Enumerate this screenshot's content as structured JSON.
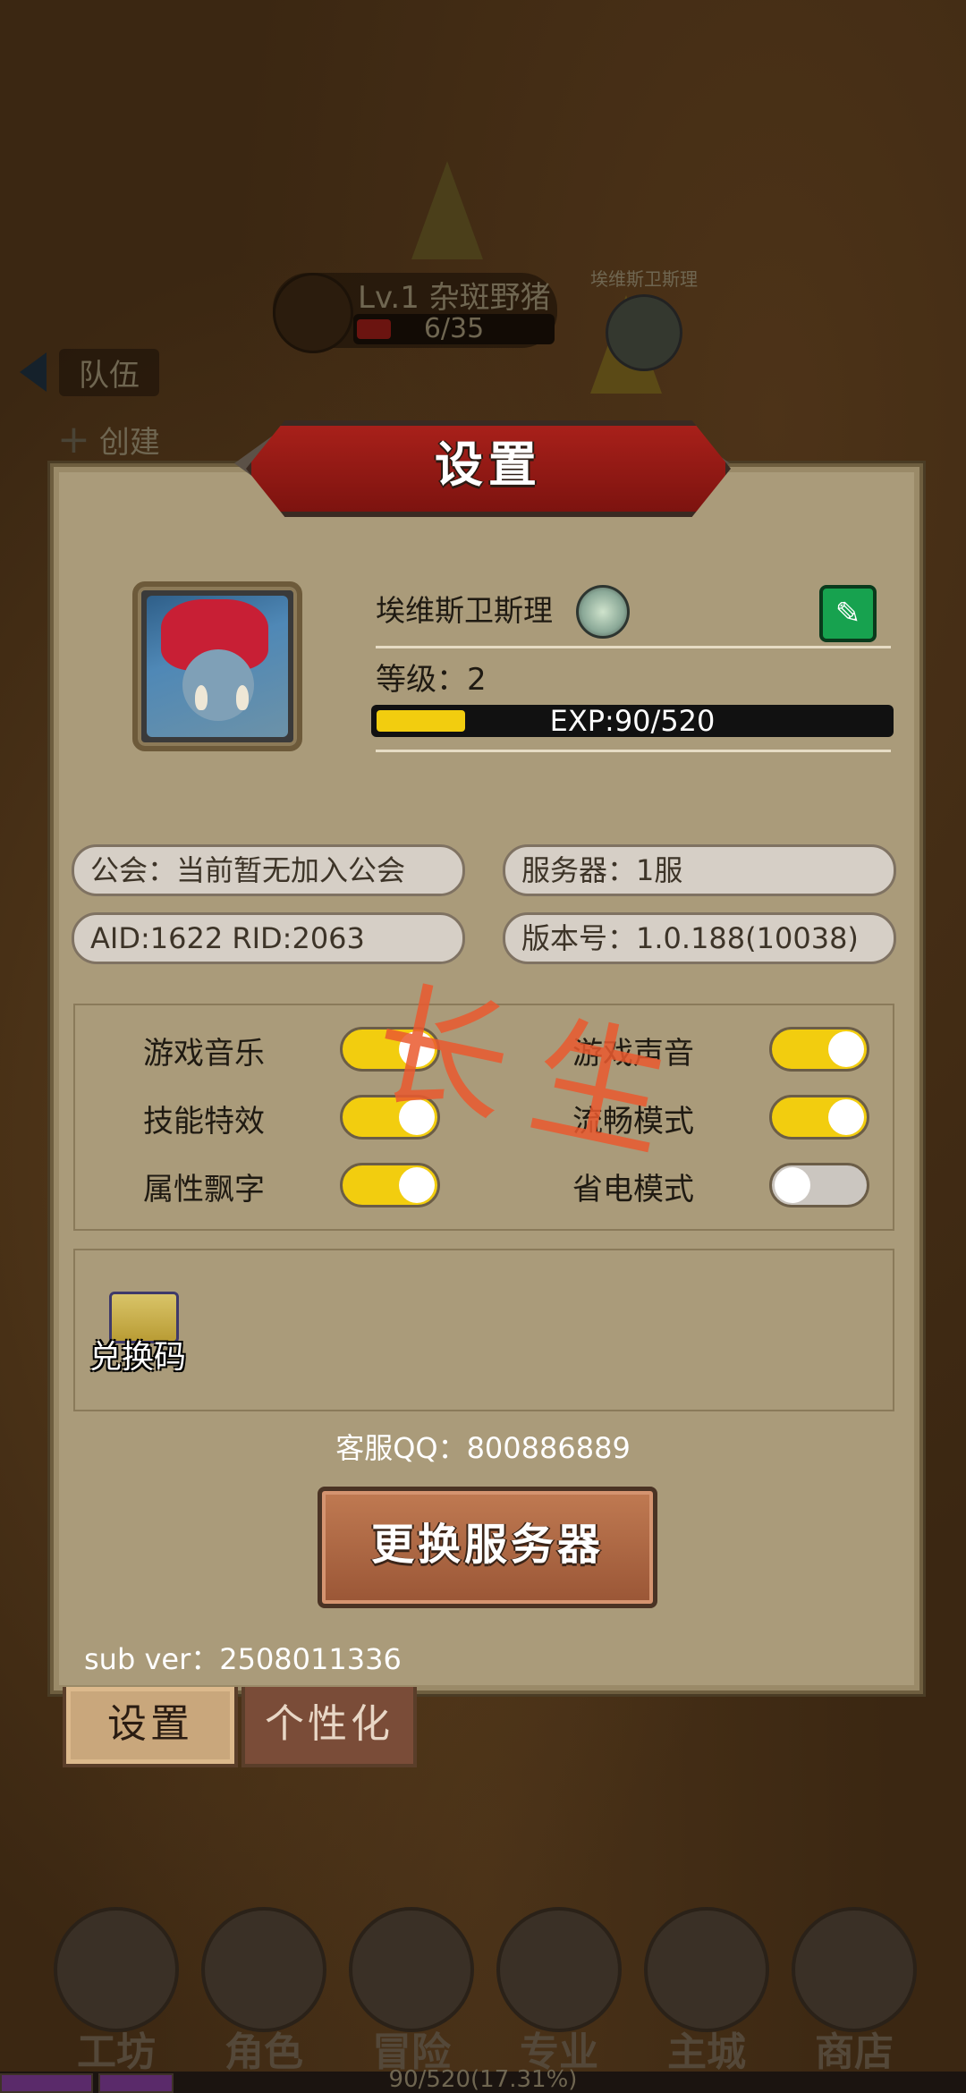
{
  "background": {
    "monster": {
      "name": "Lv.1 杂斑野猪",
      "hp": "6/35"
    },
    "player_marker": {
      "name": "埃维斯卫斯理"
    },
    "team_label": "队伍",
    "create_label": "创建"
  },
  "panel": {
    "title": "设置",
    "player": {
      "name": "埃维斯卫斯理",
      "level_label": "等级：2",
      "exp_text": "EXP:90/520",
      "exp_fraction": 0.1731
    },
    "info": {
      "guild": "公会：当前暂无加入公会",
      "server": "服务器：1服",
      "ids": "AID:1622  RID:2063",
      "version": "版本号：1.0.188(10038)"
    },
    "toggles": [
      {
        "label": "游戏音乐",
        "on": true
      },
      {
        "label": "游戏声音",
        "on": true
      },
      {
        "label": "技能特效",
        "on": true
      },
      {
        "label": "流畅模式",
        "on": true
      },
      {
        "label": "属性飘字",
        "on": true
      },
      {
        "label": "省电模式",
        "on": false
      }
    ],
    "redeem_label": "兑换码",
    "support_qq": "客服QQ：800886889",
    "change_server_label": "更换服务器",
    "sub_ver": "sub ver：2508011336",
    "watermark": "长生"
  },
  "tabs": {
    "settings": "设置",
    "personalize": "个性化"
  },
  "nav": [
    "工坊",
    "角色",
    "冒险",
    "专业",
    "主城",
    "商店"
  ],
  "bottom_text": "90/520(17.31%)",
  "colors": {
    "accent_yellow": "#f2cd0f",
    "panel_bg": "#aa9b7a",
    "edit_green": "#17a24f",
    "banner_red": "#a8201a"
  }
}
